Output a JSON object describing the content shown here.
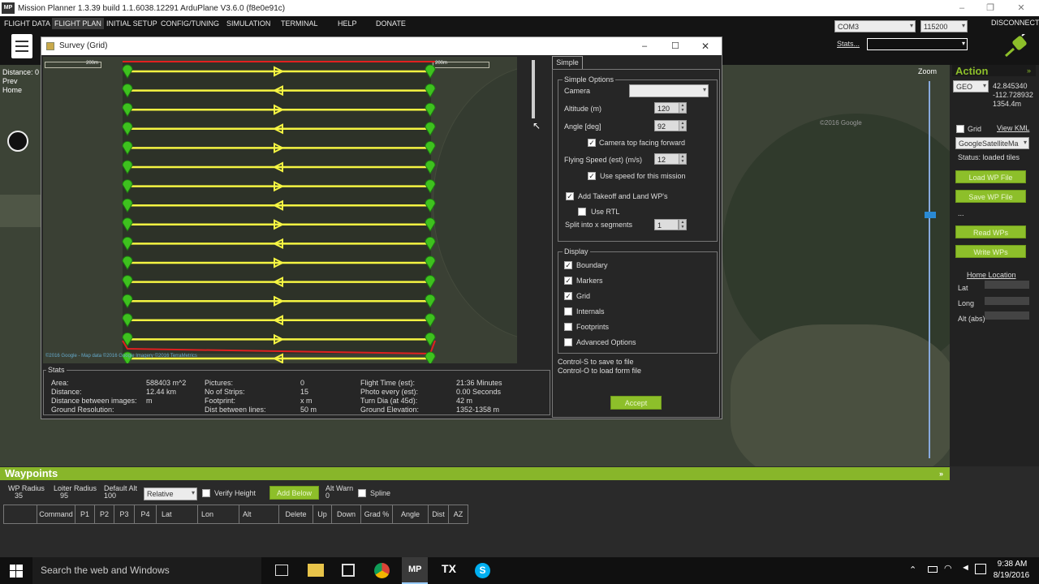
{
  "window": {
    "title": "Mission Planner 1.3.39 build 1.1.6038.12291 ArduPlane V3.6.0 (f8e0e91c)",
    "logo": "MP"
  },
  "menu": [
    "FLIGHT DATA",
    "FLIGHT PLAN",
    "INITIAL SETUP",
    "CONFIG/TUNING",
    "SIMULATION",
    "TERMINAL",
    "HELP",
    "DONATE"
  ],
  "connection": {
    "port": "COM3",
    "baud": "115200",
    "stats_label": "Stats...",
    "disconnect": "DISCONNECT"
  },
  "map_overlay": {
    "distance": "Distance: 0",
    "prev": "Prev",
    "home": "Home",
    "zoom_label": "Zoom",
    "copyright": "©2016 Google"
  },
  "action": {
    "title": "Action",
    "coord_mode": "GEO",
    "lat": "42.845340",
    "lon": "-112.728932",
    "alt": "1354.4m",
    "grid_label": "Grid",
    "view_kml": "View KML",
    "map_provider": "GoogleSatelliteMa",
    "status": "Status: loaded tiles",
    "load_wp": "Load WP File",
    "save_wp": "Save WP File",
    "dots": "...",
    "read_wp": "Read WPs",
    "write_wp": "Write WPs",
    "home_location": "Home Location",
    "lat_label": "Lat",
    "long_label": "Long",
    "alt_label": "Alt (abs)"
  },
  "waypoints": {
    "title": "Waypoints",
    "wp_radius_label": "WP Radius",
    "wp_radius": "35",
    "loiter_radius_label": "Loiter Radius",
    "loiter_radius": "95",
    "default_alt_label": "Default Alt",
    "default_alt": "100",
    "alt_mode": "Relative",
    "verify_height": "Verify Height",
    "add_below": "Add Below",
    "alt_warn_label": "Alt Warn",
    "alt_warn": "0",
    "spline": "Spline",
    "columns": [
      "Command",
      "P1",
      "P2",
      "P3",
      "P4",
      "Lat",
      "Lon",
      "Alt",
      "Delete",
      "Up",
      "Down",
      "Grad %",
      "Angle",
      "Dist",
      "AZ"
    ]
  },
  "survey": {
    "title": "Survey (Grid)",
    "tab": "Simple",
    "simple_options": "Simple Options",
    "camera_label": "Camera",
    "altitude_label": "Altitude (m)",
    "altitude": "120",
    "angle_label": "Angle [deg]",
    "angle": "92",
    "camera_top_forward": "Camera top facing forward",
    "flying_speed_label": "Flying Speed (est) (m/s)",
    "flying_speed": "12",
    "use_speed": "Use speed for this mission",
    "add_takeoff_land": "Add Takeoff and Land WP's",
    "use_rtl": "Use RTL",
    "split_label": "Split into x segments",
    "split": "1",
    "display_label": "Display",
    "display_options": [
      {
        "label": "Boundary",
        "checked": true
      },
      {
        "label": "Markers",
        "checked": true
      },
      {
        "label": "Grid",
        "checked": true
      },
      {
        "label": "Internals",
        "checked": false
      },
      {
        "label": "Footprints",
        "checked": false
      },
      {
        "label": "Advanced Options",
        "checked": false
      }
    ],
    "hint_save": "Control-S to save to file",
    "hint_load": "Control-O to load form file",
    "accept": "Accept",
    "stats_title": "Stats",
    "stats": {
      "area_label": "Area:",
      "area": "588403 m^2",
      "distance_label": "Distance:",
      "distance": "12.44 km",
      "dist_images_label": "Distance between images:",
      "dist_images": "m",
      "ground_res_label": "Ground Resolution:",
      "ground_res": "",
      "pictures_label": "Pictures:",
      "pictures": "0",
      "strips_label": "No of Strips:",
      "strips": "15",
      "footprint_label": "Footprint:",
      "footprint": "x  m",
      "dist_lines_label": "Dist between lines:",
      "dist_lines": "50 m",
      "flight_time_label": "Flight Time (est):",
      "flight_time": "21:36 Minutes",
      "photo_every_label": "Photo every (est):",
      "photo_every": "0.00 Seconds",
      "turn_dia_label": "Turn Dia (at 45d):",
      "turn_dia": "42 m",
      "ground_elev_label": "Ground Elevation:",
      "ground_elev": "1352-1358 m"
    },
    "scale_left": "200m",
    "scale_right": "200m",
    "map_copyright": "©2016 Google - Map data ©2016 Google Imagery ©2016 TerraMetrics"
  },
  "taskbar": {
    "search": "Search the web and Windows",
    "time": "9:38 AM",
    "date": "8/19/2016"
  },
  "colors": {
    "accent": "#8dbf2a",
    "flight_line": "#f5f542",
    "marker": "#3ec11e",
    "boundary": "#e02020"
  }
}
